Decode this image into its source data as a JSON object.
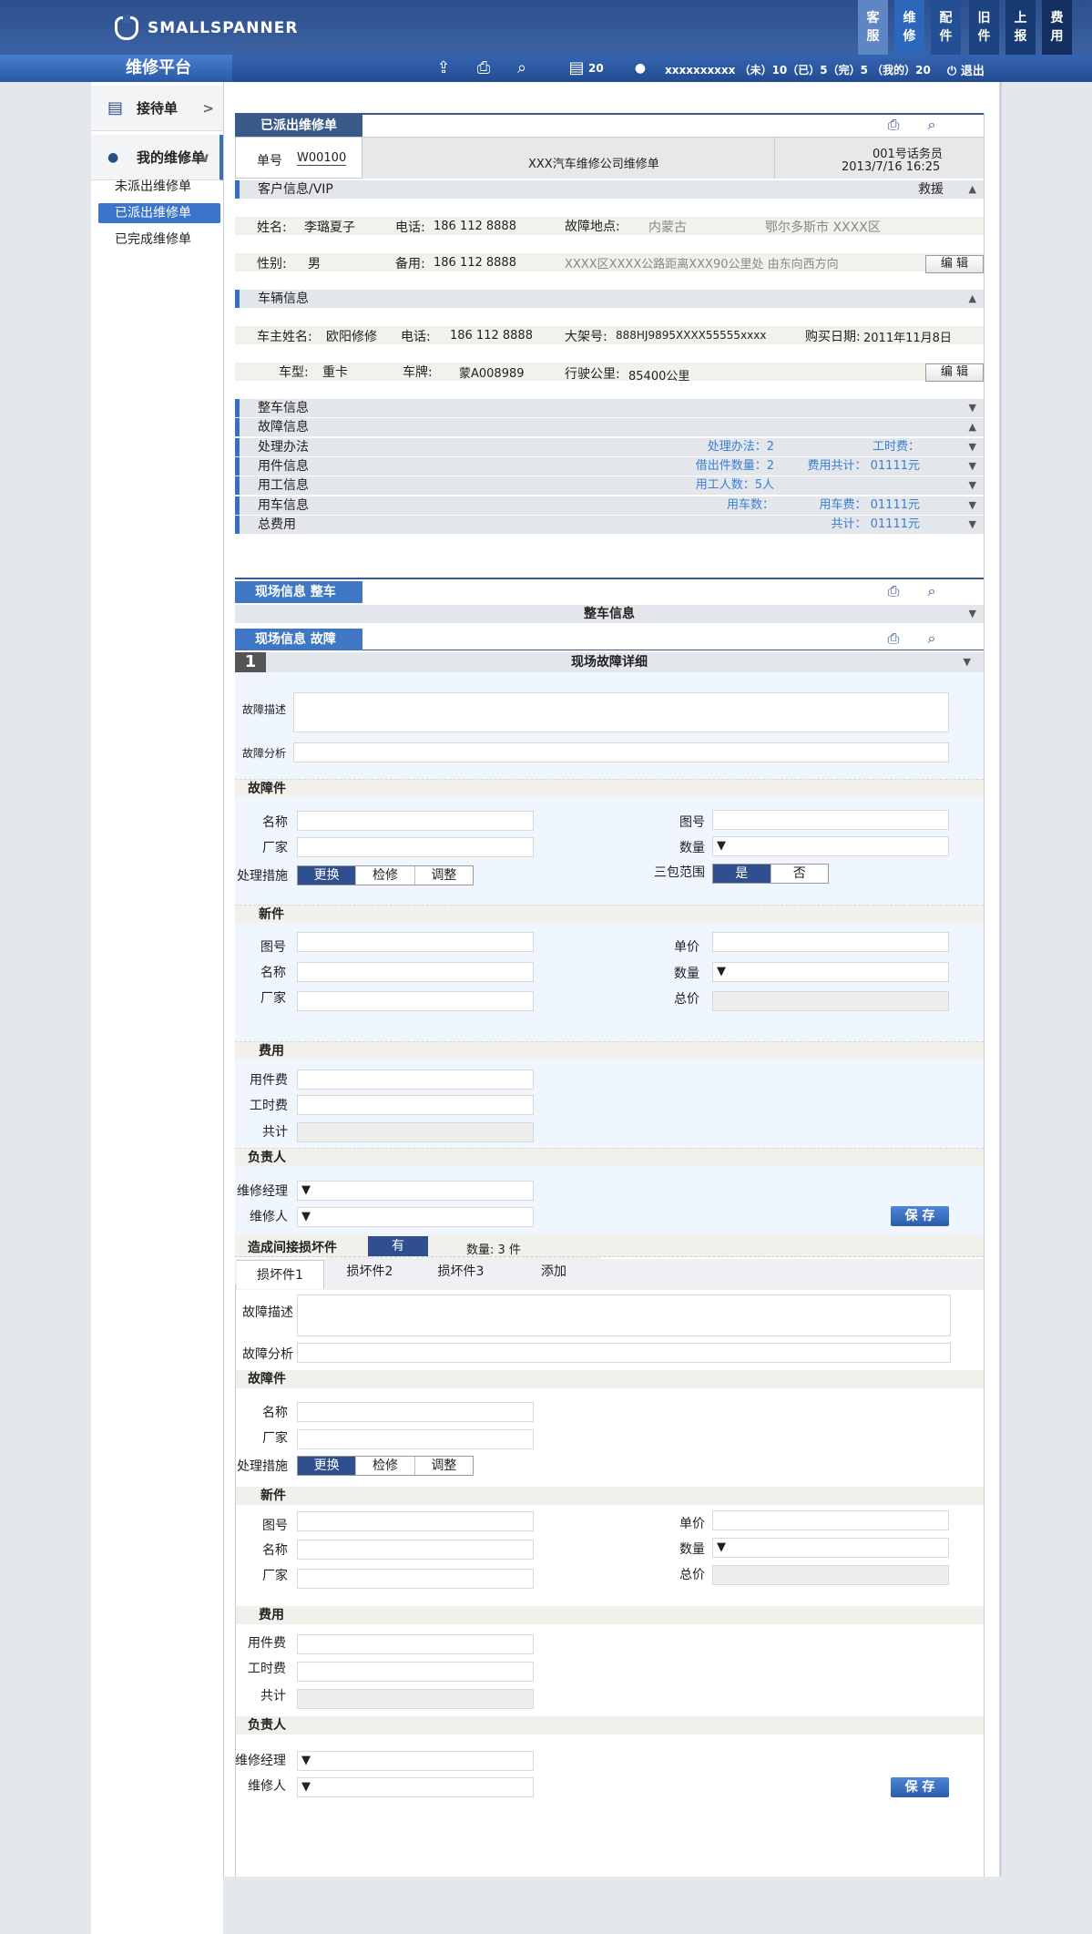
{
  "brand": {
    "name": "SMALLSPANNER",
    "platform": "维修平台"
  },
  "modules": [
    {
      "label": "客服",
      "color": "#5e86c4"
    },
    {
      "label": "维修",
      "color": "#2d67bb"
    },
    {
      "label": "配件",
      "color": "#244f95"
    },
    {
      "label": "旧件",
      "color": "#1c4380"
    },
    {
      "label": "上报",
      "color": "#173a72"
    },
    {
      "label": "费用",
      "color": "#122f60"
    }
  ],
  "toolbar": {
    "count": "20",
    "user": "xxxxxxxxxx （未）10（已）5（完）5 （我的）20",
    "logout": "退出"
  },
  "sidebar": {
    "sections": [
      {
        "label": "接待单",
        "arrow": ">"
      },
      {
        "label": "我的维修单",
        "arrow": "∨"
      }
    ],
    "items": [
      "未派出维修单",
      "已派出维修单",
      "已完成维修单"
    ],
    "active_index": 1
  },
  "order": {
    "tab": "已派出维修单",
    "number_label": "单号",
    "number": "W00100",
    "company": "XXX汽车维修公司维修单",
    "operator": "001号话务员",
    "datetime": "2013/7/16  16:25"
  },
  "customer": {
    "section": "客户信息/VIP",
    "rescue": "救援",
    "name_label": "姓名:",
    "name": "李璐夏子",
    "phone_label": "电话:",
    "phone": "186 112 8888",
    "fault_loc_label": "故障地点:",
    "fault_loc_province": "内蒙古",
    "fault_loc_city": "鄂尔多斯市  XXXX区",
    "gender_label": "性别:",
    "gender": "男",
    "backup_label": "备用:",
    "backup": "186 112 8888",
    "address": "XXXX区XXXX公路距离XXX90公里处 由东向西方向",
    "edit": "编 辑"
  },
  "vehicle": {
    "section": "车辆信息",
    "owner_label": "车主姓名:",
    "owner": "欧阳修修",
    "phone_label": "电话:",
    "phone": "186 112 8888",
    "frame_label": "大架号:",
    "frame": "888HJ9895XXXX55555xxxx",
    "buy_label": "购买日期:",
    "buy_date": "2011年11月8日",
    "type_label": "车型:",
    "type": "重卡",
    "plate_label": "车牌:",
    "plate": "蒙A008989",
    "mileage_label": "行驶公里:",
    "mileage": "85400公里",
    "edit": "编 辑"
  },
  "bands": [
    {
      "label": "整车信息",
      "r1": "",
      "r2": "",
      "arrow": "▼"
    },
    {
      "label": "故障信息",
      "r1": "",
      "r2": "",
      "arrow": "▲"
    },
    {
      "label": "处理办法",
      "r1": "处理办法：2",
      "r2": "工时费：",
      "arrow": "▼"
    },
    {
      "label": "用件信息",
      "r1": "借出件数量：2",
      "r2": "费用共计：  01111元",
      "arrow": "▼"
    },
    {
      "label": "用工信息",
      "r1": "用工人数：5人",
      "r2": "",
      "arrow": "▼"
    },
    {
      "label": "用车信息",
      "r1": "用车数：",
      "r2": "用车费：  01111元",
      "arrow": "▼"
    },
    {
      "label": "总费用",
      "r1": "",
      "r2": "共计：  01111元",
      "arrow": "▼"
    }
  ],
  "site1": {
    "tab": "现场信息   整车",
    "band": "整车信息"
  },
  "site2": {
    "tab": "现场信息   故障",
    "num": "1",
    "band": "现场故障详细"
  },
  "form": {
    "desc": "故障描述",
    "analysis": "故障分析",
    "faulty_part": "故障件",
    "name": "名称",
    "maker": "厂家",
    "drawing": "图号",
    "qty": "数量",
    "measure": "处理措施",
    "measures": [
      "更换",
      "检修",
      "调整"
    ],
    "warranty": "三包范围",
    "yesno": [
      "是",
      "否"
    ],
    "new_part": "新件",
    "unit_price": "单价",
    "total_price": "总价",
    "cost": "费用",
    "part_fee": "用件费",
    "labor_fee": "工时费",
    "total": "共计",
    "owner": "负责人",
    "manager": "维修经理",
    "repairer": "维修人",
    "save": "保 存",
    "indirect": "造成间接损坏件",
    "indirect_yes": "有",
    "indirect_count": "数量:  3 件",
    "subtabs": [
      "损坏件1",
      "损坏件2",
      "损坏件3",
      "添加"
    ]
  }
}
